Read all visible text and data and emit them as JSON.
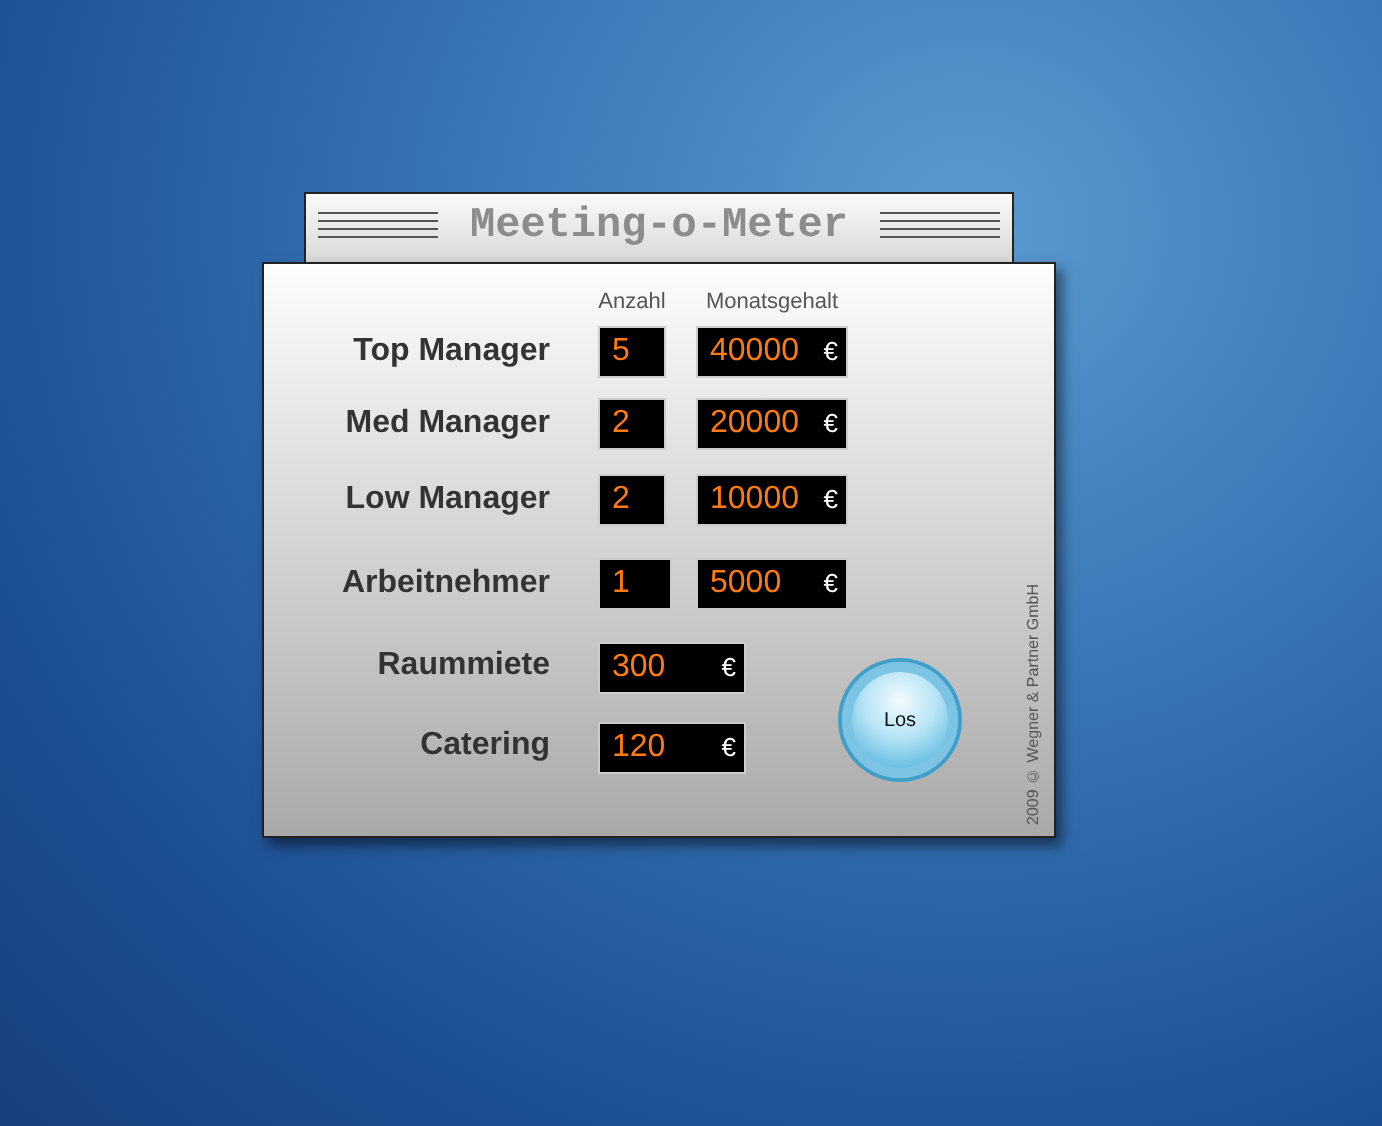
{
  "title": "Meeting-o-Meter",
  "column_headers": [
    "Anzahl",
    "Monatsgehalt"
  ],
  "positions": [
    {
      "label": "Top Manager",
      "count": "5",
      "salary": "40000",
      "currency": "€"
    },
    {
      "label": "Med Manager",
      "count": "2",
      "salary": "20000",
      "currency": "€"
    },
    {
      "label": "Low Manager",
      "count": "2",
      "salary": "10000",
      "currency": "€"
    },
    {
      "label": "Arbeitnehmer",
      "count": "1",
      "salary": "5000",
      "currency": "€"
    }
  ],
  "costs": [
    {
      "label": "Raummiete",
      "value": "300",
      "currency": "€"
    },
    {
      "label": "Catering",
      "value": "120",
      "currency": "€"
    }
  ],
  "button": "Los",
  "copyright": "2009 © Wegner & Partner GmbH"
}
